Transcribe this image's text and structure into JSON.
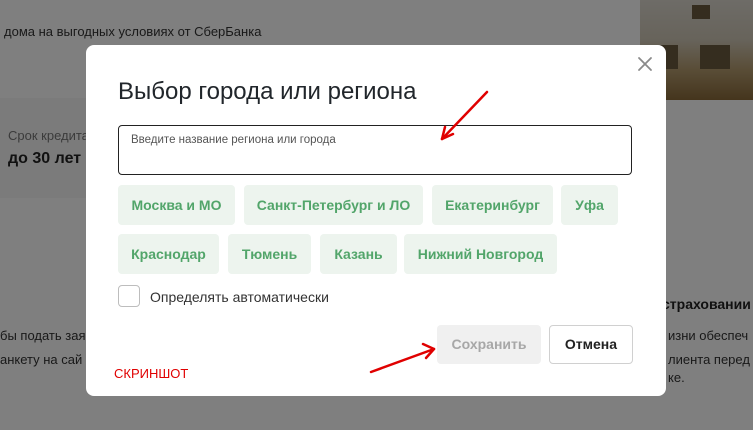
{
  "background": {
    "promo_text": "дома на выгодных условиях от СберБанка",
    "term_label": "Срок кредита",
    "term_value": "до 30 лет",
    "insurance_heading": "страховании",
    "left_text_1": "бы подать зая",
    "left_text_2": "анкету на сай",
    "right_text_1": "изни обеспеч",
    "right_text_2": "лиента перед",
    "right_text_3": "ке."
  },
  "modal": {
    "title": "Выбор города или региона",
    "search_placeholder": "Введите название региона или города",
    "search_value": "",
    "cities": [
      "Москва и МО",
      "Санкт-Петербург и ЛО",
      "Екатеринбург",
      "Уфа",
      "Краснодар",
      "Тюмень",
      "Казань",
      "Нижний Новгород"
    ],
    "auto_detect_label": "Определять автоматически",
    "auto_detect_checked": false,
    "save_label": "Сохранить",
    "cancel_label": "Отмена",
    "close_icon": "close-icon"
  },
  "annotation": {
    "watermark": "СКРИНШОТ",
    "arrow_color": "#e00000"
  }
}
